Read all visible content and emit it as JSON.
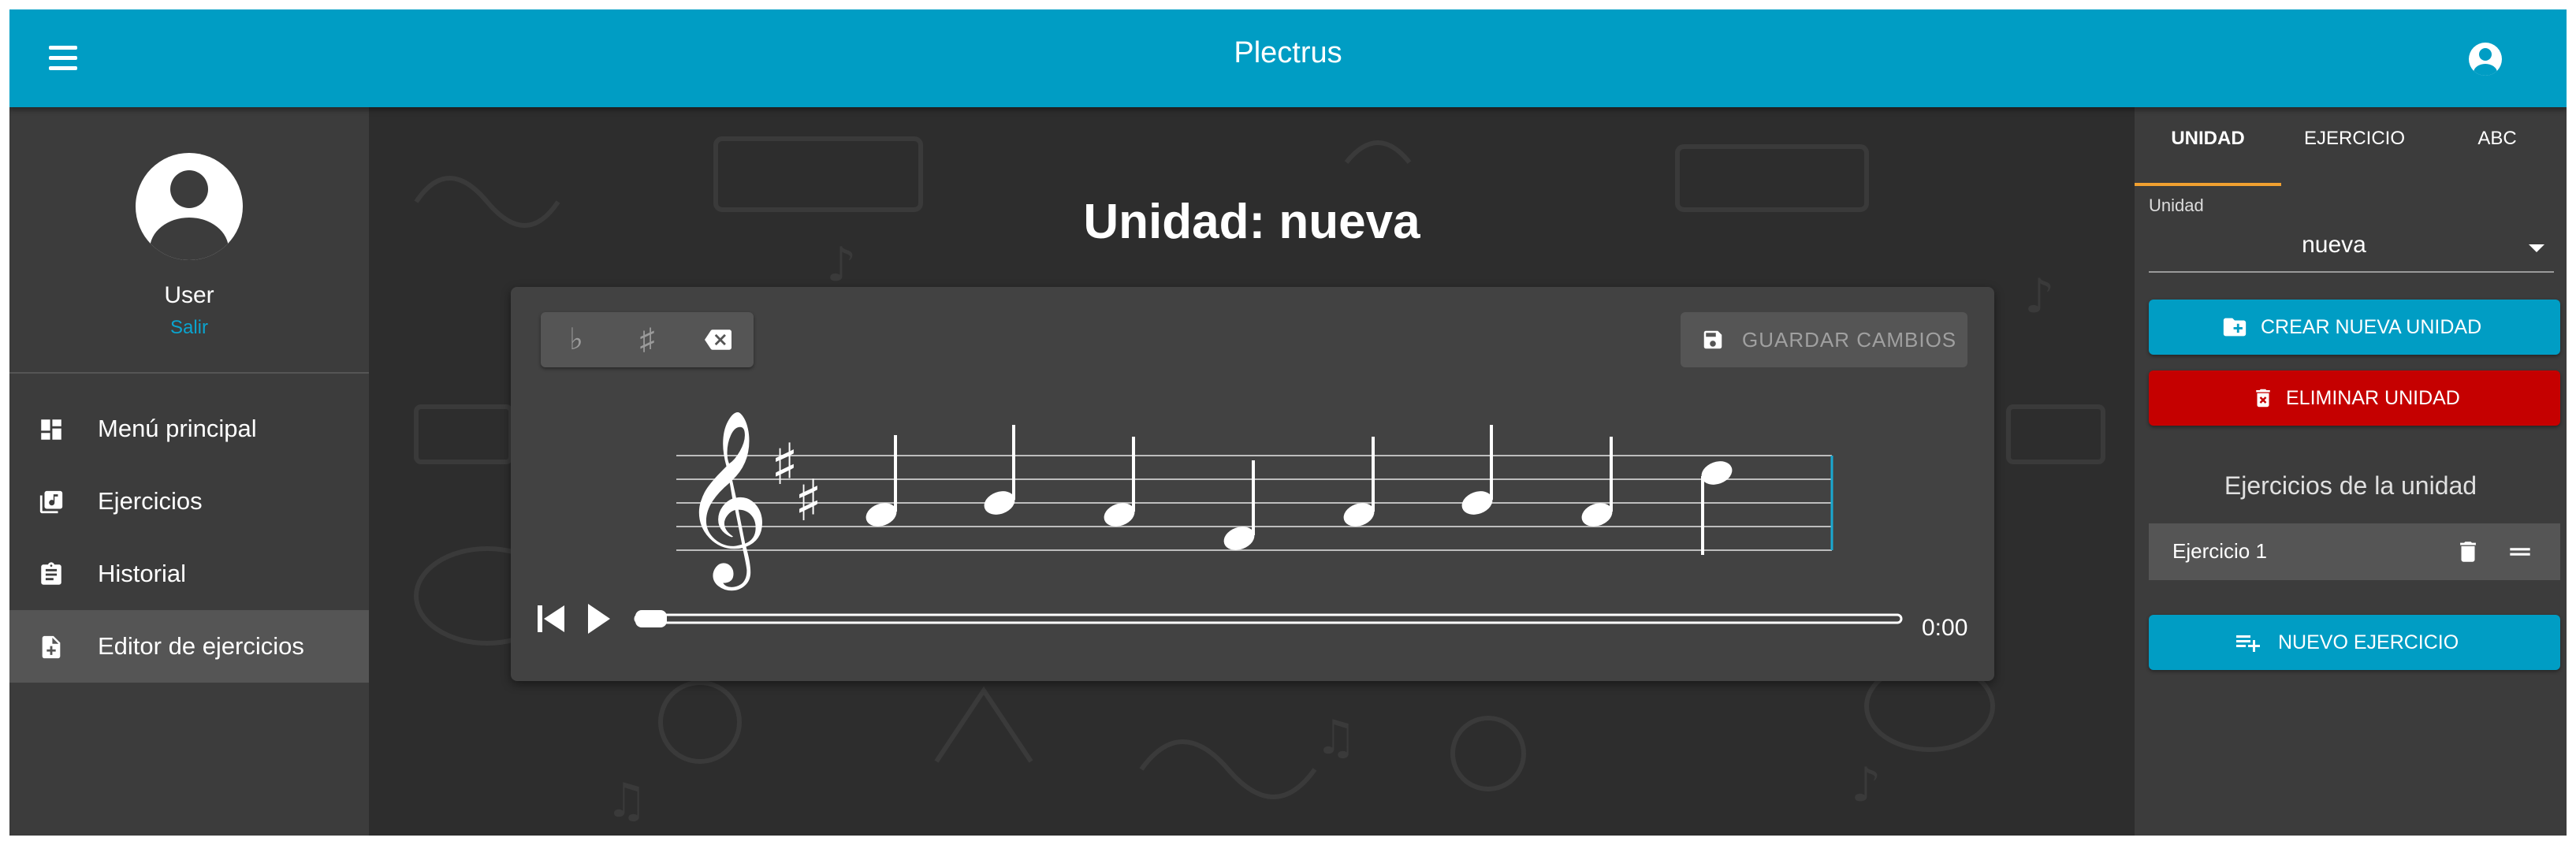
{
  "app": {
    "title": "Plectrus"
  },
  "icons": {
    "menu": "menu-icon",
    "account": "account-circle-icon",
    "flat": "flat-icon",
    "sharp": "sharp-icon",
    "backspace": "backspace-icon",
    "save": "save-icon",
    "skip_back": "skip-previous-icon",
    "play": "play-icon",
    "create_folder": "create-new-folder-icon",
    "delete": "delete-icon",
    "drag": "drag-handle-icon",
    "playlist_add": "playlist-add-icon"
  },
  "colors": {
    "topbar": "#009dc4",
    "primary_button": "#009dc4",
    "danger_button": "#c50000",
    "tab_indicator": "#f0a030",
    "link": "#0aa4cf"
  },
  "sidebar": {
    "user_name": "User",
    "logout_label": "Salir",
    "items": [
      {
        "label": "Menú principal",
        "icon": "dashboard-icon",
        "active": false
      },
      {
        "label": "Ejercicios",
        "icon": "library-music-icon",
        "active": false
      },
      {
        "label": "Historial",
        "icon": "assignment-icon",
        "active": false
      },
      {
        "label": "Editor de ejercicios",
        "icon": "note-add-icon",
        "active": true
      }
    ]
  },
  "main": {
    "title": "Unidad: nueva",
    "toolbar": {
      "flat": "♭",
      "sharp": "♯",
      "save_label": "GUARDAR CAMBIOS"
    },
    "player": {
      "time": "0:00",
      "progress": 0
    }
  },
  "right_panel": {
    "tabs": [
      {
        "label": "UNIDAD",
        "active": true
      },
      {
        "label": "EJERCICIO",
        "active": false
      },
      {
        "label": "ABC",
        "active": false
      }
    ],
    "unit_field_label": "Unidad",
    "unit_selected": "nueva",
    "create_unit_label": "CREAR NUEVA UNIDAD",
    "delete_unit_label": "ELIMINAR UNIDAD",
    "exercises_section_title": "Ejercicios de la unidad",
    "exercises": [
      {
        "name": "Ejercicio 1"
      }
    ],
    "new_exercise_label": "NUEVO EJERCICIO"
  }
}
